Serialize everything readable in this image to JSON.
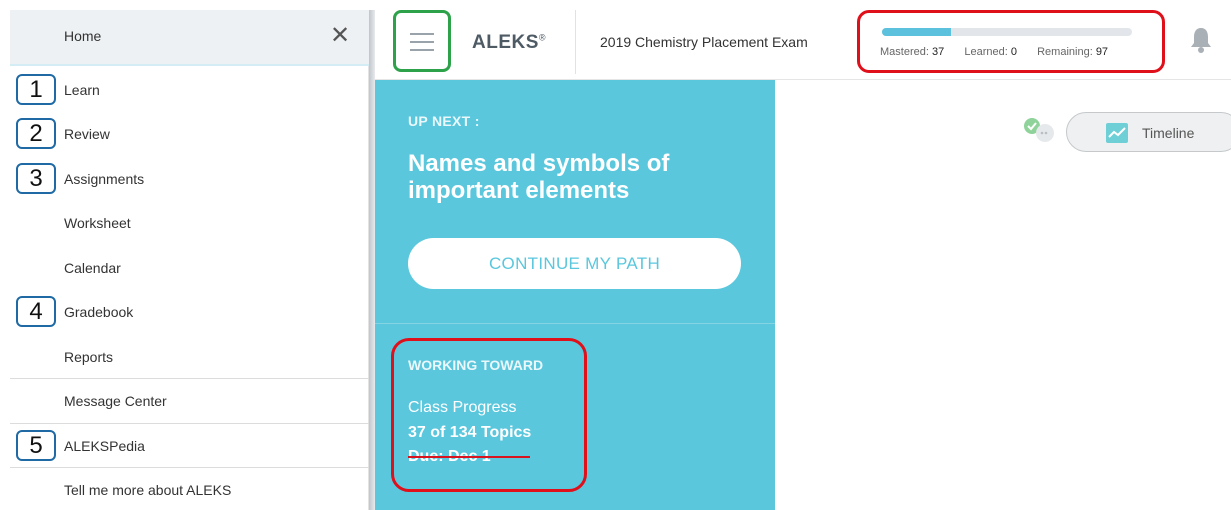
{
  "sidebar": {
    "home_label": "Home",
    "close_glyph": "✕",
    "items": [
      {
        "label": "Learn",
        "badge": "1"
      },
      {
        "label": "Review",
        "badge": "2"
      },
      {
        "label": "Assignments",
        "badge": "3"
      },
      {
        "label": "Worksheet",
        "badge": ""
      },
      {
        "label": "Calendar",
        "badge": ""
      },
      {
        "label": "Gradebook",
        "badge": "4"
      },
      {
        "label": "Reports",
        "badge": ""
      },
      {
        "label": "Message Center",
        "badge": ""
      },
      {
        "label": "ALEKSPedia",
        "badge": "5"
      },
      {
        "label": "Tell me more about ALEKS",
        "badge": ""
      }
    ]
  },
  "header": {
    "logo": "ALEKS",
    "logo_mark": "®",
    "exam_title": "2019 Chemistry Placement Exam",
    "progress": {
      "mastered_label": "Mastered:",
      "mastered": "37",
      "learned_label": "Learned:",
      "learned": "0",
      "remaining_label": "Remaining:",
      "remaining": "97",
      "mastered_fraction": 0.276
    }
  },
  "panel": {
    "up_next_label": "UP NEXT :",
    "topic_title": "Names and symbols of important elements",
    "continue_label": "CONTINUE MY PATH",
    "working_toward_label": "WORKING TOWARD",
    "class_progress_label": "Class Progress",
    "topics_count": "37 of 134 Topics",
    "due_date": "Due: Dec 1"
  },
  "right": {
    "timeline_label": "Timeline"
  },
  "colors": {
    "accent_teal": "#5ac7dd",
    "annotation_red": "#e0101b",
    "annotation_green": "#2ea24a",
    "annotation_blue": "#1f6aa5"
  },
  "icons": [
    "close-icon",
    "hamburger-menu-icon",
    "bell-icon",
    "check-bubble-icon",
    "timeline-chart-icon"
  ]
}
